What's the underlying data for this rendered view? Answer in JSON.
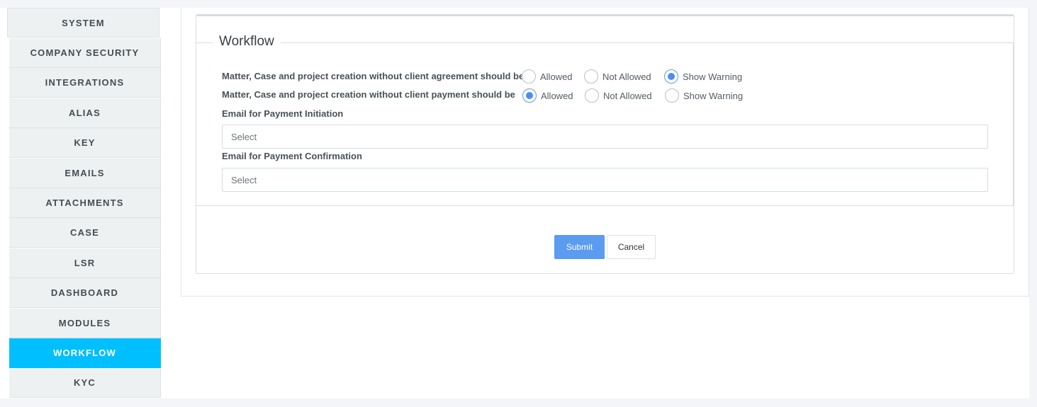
{
  "sidebar": {
    "items": [
      {
        "label": "SYSTEM"
      },
      {
        "label": "COMPANY SECURITY"
      },
      {
        "label": "INTEGRATIONS"
      },
      {
        "label": "ALIAS"
      },
      {
        "label": "KEY"
      },
      {
        "label": "EMAILS"
      },
      {
        "label": "ATTACHMENTS"
      },
      {
        "label": "CASE"
      },
      {
        "label": "LSR"
      },
      {
        "label": "DASHBOARD"
      },
      {
        "label": "MODULES"
      },
      {
        "label": "WORKFLOW"
      },
      {
        "label": "KYC"
      }
    ],
    "active": "WORKFLOW",
    "active_color": "#00bfff"
  },
  "workflow": {
    "legend": "Workflow",
    "questions": [
      {
        "label": "Matter, Case and project creation without client agreement should be",
        "options": [
          "Allowed",
          "Not Allowed",
          "Show Warning"
        ],
        "selected": "Show Warning"
      },
      {
        "label": "Matter, Case and project creation without client payment should be",
        "options": [
          "Allowed",
          "Not Allowed",
          "Show Warning"
        ],
        "selected": "Allowed"
      }
    ],
    "payment_initiation": {
      "label": "Email for Payment Initiation",
      "placeholder": "Select"
    },
    "payment_confirmation": {
      "label": "Email for Payment Confirmation",
      "placeholder": "Select"
    }
  },
  "actions": {
    "submit": "Submit",
    "cancel": "Cancel",
    "accent_color": "#5b9bf0"
  }
}
